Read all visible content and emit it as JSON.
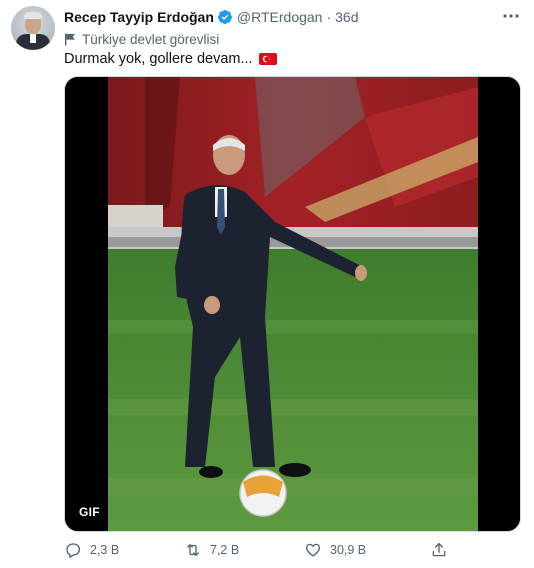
{
  "tweet": {
    "display_name": "Recep Tayyip Erdoğan",
    "handle": "@RTErdogan",
    "separator": "·",
    "time": "36d",
    "account_label": "Türkiye devlet görevlisi",
    "text": "Durmak yok, gollere devam...",
    "media_badge": "GIF",
    "verified": true
  },
  "icons": {
    "verified": "verified-badge-icon",
    "more": "more-dots-icon",
    "label": "flag-label-icon",
    "emoji": "turkey-flag-emoji",
    "reply": "reply-icon",
    "retweet": "retweet-icon",
    "like": "heart-icon",
    "share": "share-icon"
  },
  "actions": {
    "replies": "2,3 B",
    "retweets": "7,2 B",
    "likes": "30,9 B"
  },
  "colors": {
    "accent": "#1d9bf0",
    "secondary_text": "#536471",
    "primary_text": "#0f1419",
    "flag_red": "#e30a17"
  }
}
